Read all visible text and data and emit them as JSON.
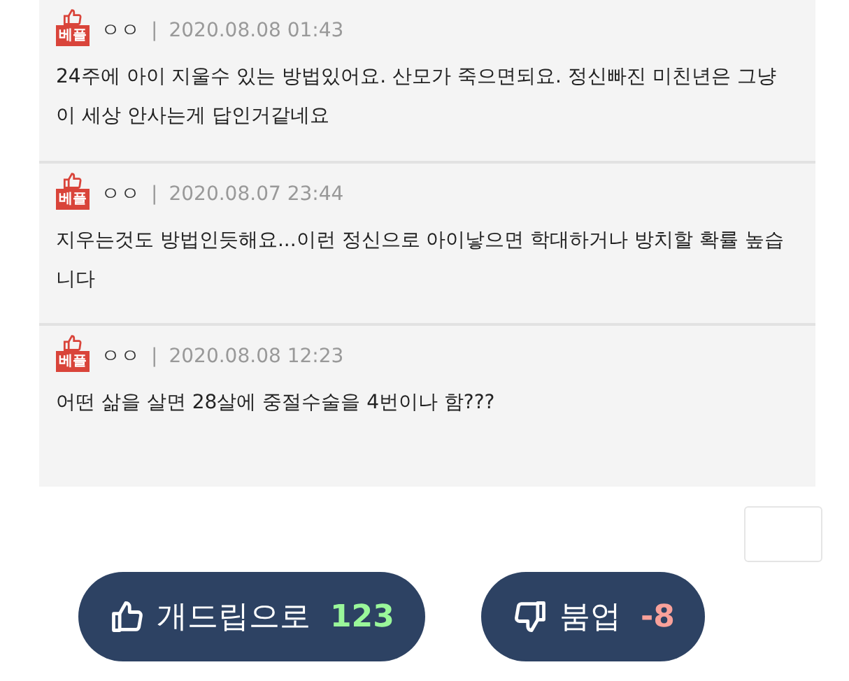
{
  "comments": [
    {
      "badge": "베플",
      "author": "ㅇㅇ",
      "separator": "|",
      "date": "2020.08.08 01:43",
      "text": "24주에 아이 지울수 있는 방법있어요. 산모가 죽으면되요. 정신빠진 미친년은 그냥 이 세상 안사는게 답인거같네요"
    },
    {
      "badge": "베플",
      "author": "ㅇㅇ",
      "separator": "|",
      "date": "2020.08.07 23:44",
      "text": "지우는것도 방법인듯해요...이런 정신으로 아이낳으면 학대하거나 방치할 확률 높습니다"
    },
    {
      "badge": "베플",
      "author": "ㅇㅇ",
      "separator": "|",
      "date": "2020.08.08 12:23",
      "text": "어떤 삶을 살면 28살에 중절수술을 4번이나 함???"
    }
  ],
  "votes": [
    {
      "kind": "up",
      "label": "개드립으로",
      "count": "123"
    },
    {
      "kind": "down",
      "label": "붐업",
      "count": "-8"
    }
  ]
}
